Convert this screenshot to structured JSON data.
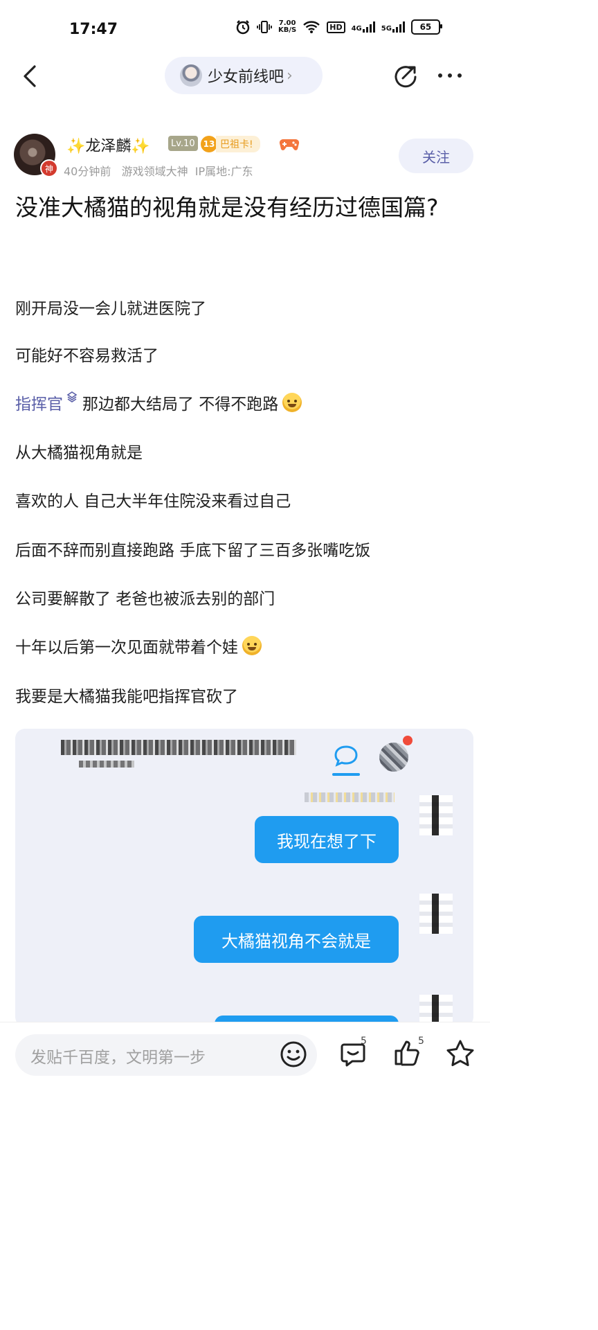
{
  "status_bar": {
    "time": "17:47",
    "net_speed_value": "7.00",
    "net_speed_unit": "KB/S",
    "hd": "HD",
    "sig1": "4G",
    "sig2": "5G",
    "battery": "65"
  },
  "nav": {
    "forum_name": "少女前线吧"
  },
  "author": {
    "name": "✨龙泽麟✨",
    "god_badge": "神",
    "level": "Lv.10",
    "member_level": "13",
    "member_title": "巴祖卡!",
    "meta": "40分钟前   游戏领域大神  IP属地:广东",
    "follow_label": "关注"
  },
  "post": {
    "title": "没准大橘猫的视角就是没有经历过德国篇?",
    "lines": [
      "刚开局没一会儿就进医院了",
      "可能好不容易救活了",
      "那边都大结局了 不得不跑路",
      "从大橘猫视角就是",
      "喜欢的人 自己大半年住院没来看过自己",
      "后面不辞而别直接跑路 手底下留了三百多张嘴吃饭",
      "公司要解散了 老爸也被派去别的部门",
      "十年以后第一次见面就带着个娃",
      "我要是大橘猫我能吧指挥官砍了"
    ],
    "mention": "指挥官"
  },
  "screenshot": {
    "bubbles": [
      "我现在想了下",
      "大橘猫视角不会就是"
    ]
  },
  "bottom_bar": {
    "placeholder": "发贴千百度，文明第一步",
    "comment_count": "5",
    "like_count": "5"
  },
  "colors": {
    "accent": "#5a5fa8",
    "bubble": "#1f9cf0",
    "pill_bg": "#eff1fb"
  }
}
